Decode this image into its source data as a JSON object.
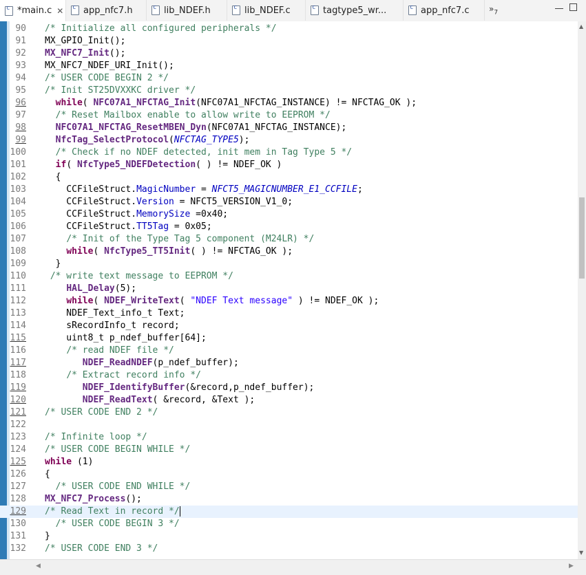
{
  "tabs": [
    {
      "label": "*main.c",
      "close": "✕",
      "active": true
    },
    {
      "label": "app_nfc7.h"
    },
    {
      "label": "lib_NDEF.h"
    },
    {
      "label": "lib_NDEF.c"
    },
    {
      "label": "tagtype5_wr..."
    },
    {
      "label": "app_nfc7.c"
    }
  ],
  "overflow_label": "»",
  "overflow_count": "7",
  "colors": {
    "comment": "#3f7f5f",
    "keyword": "#7f0055",
    "field": "#0000c0",
    "string": "#2a00ff",
    "current_line": "#e8f2fe",
    "ruler": "#2e7bb6"
  },
  "editor": {
    "current_line": 129,
    "lines": [
      {
        "n": 90,
        "segs": [
          {
            "t": "/* Initialize all configured peripherals */",
            "c": "cm"
          }
        ]
      },
      {
        "n": 91,
        "segs": [
          {
            "t": "MX_GPIO_Init();",
            "c": ""
          }
        ]
      },
      {
        "n": 92,
        "segs": [
          {
            "t": "MX_NFC7_Init",
            "c": "fn"
          },
          {
            "t": "();",
            "c": ""
          }
        ]
      },
      {
        "n": 93,
        "segs": [
          {
            "t": "MX_NFC7_NDEF_URI_Init();",
            "c": ""
          }
        ]
      },
      {
        "n": 94,
        "segs": [
          {
            "t": "/* USER CODE BEGIN 2 */",
            "c": "cm"
          }
        ]
      },
      {
        "n": 95,
        "segs": [
          {
            "t": "/* Init ST25DVXXKC driver */",
            "c": "cm"
          }
        ]
      },
      {
        "n": 96,
        "u": true,
        "segs": [
          {
            "t": "  "
          },
          {
            "t": "while",
            "c": "kw"
          },
          {
            "t": "( "
          },
          {
            "t": "NFC07A1_NFCTAG_Init",
            "c": "fn"
          },
          {
            "t": "(NFC07A1_NFCTAG_INSTANCE) != NFCTAG_OK );"
          }
        ]
      },
      {
        "n": 97,
        "segs": [
          {
            "t": "  "
          },
          {
            "t": "/* Reset Mailbox enable to allow write to EEPROM */",
            "c": "cm"
          }
        ]
      },
      {
        "n": 98,
        "u": true,
        "segs": [
          {
            "t": "  "
          },
          {
            "t": "NFC07A1_NFCTAG_ResetMBEN_Dyn",
            "c": "fn"
          },
          {
            "t": "(NFC07A1_NFCTAG_INSTANCE);"
          }
        ]
      },
      {
        "n": 99,
        "u": true,
        "segs": [
          {
            "t": "  "
          },
          {
            "t": "NfcTag_SelectProtocol",
            "c": "fn"
          },
          {
            "t": "("
          },
          {
            "t": "NFCTAG_TYPE5",
            "c": "mac"
          },
          {
            "t": ");"
          }
        ]
      },
      {
        "n": 100,
        "segs": [
          {
            "t": "  "
          },
          {
            "t": "/* Check if no NDEF detected, init mem in Tag Type 5 */",
            "c": "cm"
          }
        ]
      },
      {
        "n": 101,
        "segs": [
          {
            "t": "  "
          },
          {
            "t": "if",
            "c": "kw"
          },
          {
            "t": "( "
          },
          {
            "t": "NfcType5_NDEFDetection",
            "c": "fn"
          },
          {
            "t": "( ) != NDEF_OK )"
          }
        ]
      },
      {
        "n": 102,
        "segs": [
          {
            "t": "  {"
          }
        ]
      },
      {
        "n": 103,
        "segs": [
          {
            "t": "    CCFileStruct."
          },
          {
            "t": "MagicNumber",
            "c": "fld"
          },
          {
            "t": " = "
          },
          {
            "t": "NFCT5_MAGICNUMBER_E1_CCFILE",
            "c": "mac"
          },
          {
            "t": ";"
          }
        ]
      },
      {
        "n": 104,
        "segs": [
          {
            "t": "    CCFileStruct."
          },
          {
            "t": "Version",
            "c": "fld"
          },
          {
            "t": " = NFCT5_VERSION_V1_0;"
          }
        ]
      },
      {
        "n": 105,
        "segs": [
          {
            "t": "    CCFileStruct."
          },
          {
            "t": "MemorySize",
            "c": "fld"
          },
          {
            "t": " =0x40;"
          }
        ]
      },
      {
        "n": 106,
        "segs": [
          {
            "t": "    CCFileStruct."
          },
          {
            "t": "TT5Tag",
            "c": "fld"
          },
          {
            "t": " = 0x05;"
          }
        ]
      },
      {
        "n": 107,
        "segs": [
          {
            "t": "    "
          },
          {
            "t": "/* Init of the Type Tag 5 component (M24LR) */",
            "c": "cm"
          }
        ]
      },
      {
        "n": 108,
        "segs": [
          {
            "t": "    "
          },
          {
            "t": "while",
            "c": "kw"
          },
          {
            "t": "( "
          },
          {
            "t": "NfcType5_TT5Init",
            "c": "fn"
          },
          {
            "t": "( ) != NFCTAG_OK );"
          }
        ]
      },
      {
        "n": 109,
        "segs": [
          {
            "t": "  }"
          }
        ]
      },
      {
        "n": 110,
        "segs": [
          {
            "t": " "
          },
          {
            "t": "/* write text message to EEPROM */",
            "c": "cm"
          }
        ]
      },
      {
        "n": 111,
        "segs": [
          {
            "t": "    "
          },
          {
            "t": "HAL_Delay",
            "c": "fn"
          },
          {
            "t": "(5);"
          }
        ]
      },
      {
        "n": 112,
        "segs": [
          {
            "t": "    "
          },
          {
            "t": "while",
            "c": "kw"
          },
          {
            "t": "( "
          },
          {
            "t": "NDEF_WriteText",
            "c": "fn"
          },
          {
            "t": "( "
          },
          {
            "t": "\"NDEF Text message\"",
            "c": "str"
          },
          {
            "t": " ) != NDEF_OK );"
          }
        ]
      },
      {
        "n": 113,
        "segs": [
          {
            "t": "    NDEF_Text_info_t Text;"
          }
        ]
      },
      {
        "n": 114,
        "segs": [
          {
            "t": "    sRecordInfo_t record;"
          }
        ]
      },
      {
        "n": 115,
        "u": true,
        "segs": [
          {
            "t": "    uint8_t p_ndef_buffer[64];"
          }
        ]
      },
      {
        "n": 116,
        "segs": [
          {
            "t": "    "
          },
          {
            "t": "/* read NDEF file */",
            "c": "cm"
          }
        ]
      },
      {
        "n": 117,
        "u": true,
        "segs": [
          {
            "t": "       "
          },
          {
            "t": "NDEF_ReadNDEF",
            "c": "fn"
          },
          {
            "t": "(p_ndef_buffer);"
          }
        ]
      },
      {
        "n": 118,
        "segs": [
          {
            "t": "    "
          },
          {
            "t": "/* Extract record info */",
            "c": "cm"
          }
        ]
      },
      {
        "n": 119,
        "u": true,
        "segs": [
          {
            "t": "       "
          },
          {
            "t": "NDEF_IdentifyBuffer",
            "c": "fn"
          },
          {
            "t": "(&record,p_ndef_buffer);"
          }
        ]
      },
      {
        "n": 120,
        "u": true,
        "segs": [
          {
            "t": "       "
          },
          {
            "t": "NDEF_ReadText",
            "c": "fn"
          },
          {
            "t": "( &record, &Text );"
          }
        ]
      },
      {
        "n": 121,
        "u": true,
        "segs": [
          {
            "t": "/* USER CODE END 2 */",
            "c": "cm"
          }
        ]
      },
      {
        "n": 122,
        "segs": []
      },
      {
        "n": 123,
        "segs": [
          {
            "t": "/* Infinite loop */",
            "c": "cm"
          }
        ]
      },
      {
        "n": 124,
        "segs": [
          {
            "t": "/* USER CODE BEGIN WHILE */",
            "c": "cm"
          }
        ]
      },
      {
        "n": 125,
        "u": true,
        "segs": [
          {
            "t": "while",
            "c": "kw"
          },
          {
            "t": " (1)"
          }
        ]
      },
      {
        "n": 126,
        "segs": [
          {
            "t": "{"
          }
        ]
      },
      {
        "n": 127,
        "segs": [
          {
            "t": "  "
          },
          {
            "t": "/* USER CODE END WHILE */",
            "c": "cm"
          }
        ]
      },
      {
        "n": 128,
        "segs": [
          {
            "t": "MX_NFC7_Process",
            "c": "fn"
          },
          {
            "t": "();"
          }
        ]
      },
      {
        "n": 129,
        "u": true,
        "segs": [
          {
            "t": "/* Read Text in record */",
            "c": "cm"
          }
        ],
        "caret": true
      },
      {
        "n": 130,
        "segs": [
          {
            "t": "  "
          },
          {
            "t": "/* USER CODE BEGIN 3 */",
            "c": "cm"
          }
        ]
      },
      {
        "n": 131,
        "segs": [
          {
            "t": "}"
          }
        ]
      },
      {
        "n": 132,
        "segs": [
          {
            "t": "/* USER CODE END 3 */",
            "c": "cm"
          }
        ]
      }
    ]
  }
}
